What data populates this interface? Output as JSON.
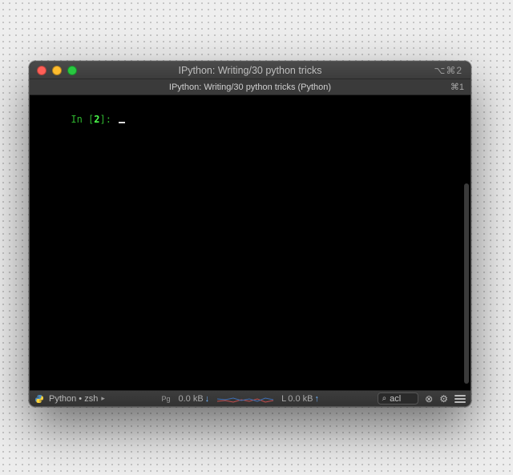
{
  "window": {
    "title": "IPython: Writing/30 python tricks",
    "titlebar_right": "⌥⌘2"
  },
  "tab": {
    "label": "IPython: Writing/30 python tricks (Python)",
    "hotkey": "⌘1"
  },
  "terminal": {
    "prompt_prefix": "In [",
    "prompt_number": "2",
    "prompt_suffix": "]: "
  },
  "status": {
    "process": "Python • zsh",
    "pager": "Pg",
    "net_down_value": "0.0 kB",
    "net_down_arrow": "↓",
    "net_up_label": "L",
    "net_up_value": "0.0 kB",
    "net_up_arrow": "↑",
    "search_icon": "⌕",
    "search_value": "acl",
    "close_icon": "⊗",
    "gear_icon": "⚙"
  }
}
